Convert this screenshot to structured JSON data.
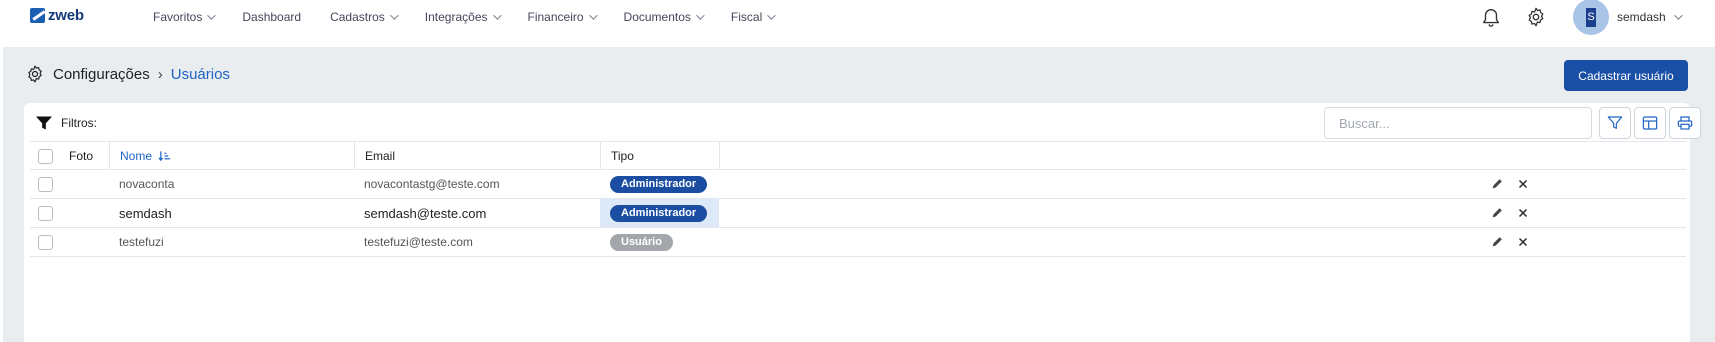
{
  "app": {
    "logo_text": "zweb"
  },
  "nav": {
    "items": [
      {
        "label": "Favoritos",
        "dropdown": true
      },
      {
        "label": "Dashboard",
        "dropdown": false
      },
      {
        "label": "Cadastros",
        "dropdown": true
      },
      {
        "label": "Integrações",
        "dropdown": true
      },
      {
        "label": "Financeiro",
        "dropdown": true
      },
      {
        "label": "Documentos",
        "dropdown": true
      },
      {
        "label": "Fiscal",
        "dropdown": true
      }
    ]
  },
  "user": {
    "initial": "S",
    "name": "semdash"
  },
  "icons": {
    "notifications": "bell-icon",
    "settings": "gear-icon"
  },
  "breadcrumb": {
    "root": "Configurações",
    "separator": "›",
    "current": "Usuários"
  },
  "actions": {
    "new_user_label": "Cadastrar usuário"
  },
  "toolbar": {
    "filters_label": "Filtros:",
    "search_placeholder": "Buscar...",
    "search_value": ""
  },
  "table": {
    "columns": {
      "foto": "Foto",
      "nome": "Nome",
      "email": "Email",
      "tipo": "Tipo"
    },
    "sort": {
      "column": "Nome",
      "direction": "ascending"
    },
    "rows": [
      {
        "nome": "novaconta",
        "email": "novacontastg@teste.com",
        "tipo": "Administrador",
        "tipo_style": "admin",
        "checked": false
      },
      {
        "nome": "semdash",
        "email": "semdash@teste.com",
        "tipo": "Administrador",
        "tipo_style": "admin",
        "checked": false
      },
      {
        "nome": "testefuzi",
        "email": "testefuzi@teste.com",
        "tipo": "Usuário",
        "tipo_style": "user",
        "checked": false
      }
    ]
  },
  "colors": {
    "primary": "#1a4fa6",
    "link": "#1e63c4",
    "badge_admin": "#1b4ea3",
    "badge_user": "#a3a6ab",
    "background": "#e9edef"
  }
}
